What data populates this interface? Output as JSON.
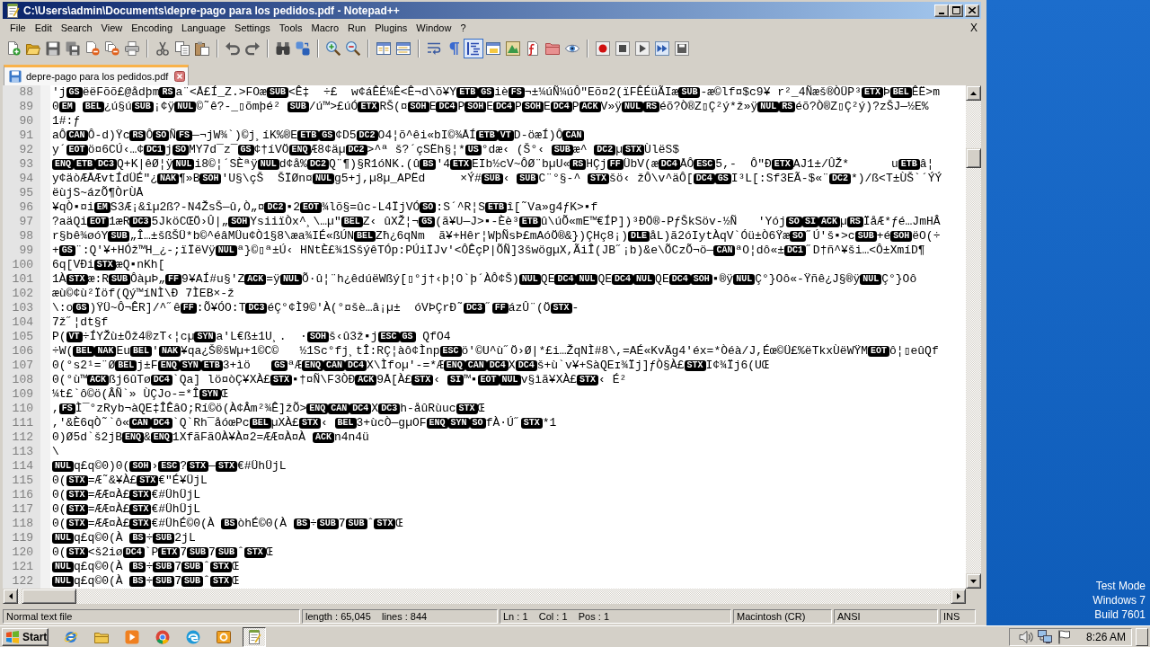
{
  "window": {
    "title": "C:\\Users\\admin\\Documents\\depre-pago para los pedidos.pdf - Notepad++"
  },
  "menu": {
    "items": [
      "File",
      "Edit",
      "Search",
      "View",
      "Encoding",
      "Language",
      "Settings",
      "Tools",
      "Macro",
      "Run",
      "Plugins",
      "Window",
      "?"
    ],
    "close_document": "X"
  },
  "toolbar": {
    "buttons": [
      {
        "pressed": false
      },
      {
        "pressed": false
      },
      {
        "pressed": false
      },
      {
        "pressed": false
      },
      {
        "pressed": false
      },
      {
        "pressed": false
      },
      {
        "pressed": false
      },
      {
        "pressed": false
      },
      {
        "pressed": false
      },
      {
        "pressed": false
      },
      {
        "pressed": false
      },
      {
        "pressed": false
      },
      {
        "pressed": false
      },
      {
        "pressed": false
      },
      {
        "pressed": false
      },
      {
        "pressed": false
      },
      {
        "pressed": false
      },
      {
        "pressed": false
      },
      {
        "pressed": false
      },
      {
        "pressed": false
      },
      {
        "pressed": true
      },
      {
        "pressed": false
      },
      {
        "pressed": false
      },
      {
        "pressed": false
      },
      {
        "pressed": false
      },
      {
        "pressed": false
      },
      {
        "pressed": false
      },
      {
        "pressed": false
      },
      {
        "pressed": false
      },
      {
        "pressed": false
      },
      {
        "pressed": false
      }
    ]
  },
  "tabs": [
    {
      "label": "depre-pago para los pedidos.pdf",
      "selected": true
    }
  ],
  "editor": {
    "lines": [
      {
        "number": "88",
        "segments": [
          {
            "kind": "text",
            "text": "'j"
          },
          {
            "kind": "control",
            "text": "GS"
          },
          {
            "kind": "text",
            "text": "ëëFõõ£@ådþm"
          },
          {
            "kind": "control",
            "text": "RS"
          },
          {
            "kind": "text",
            "text": "a¨<Å£Í_Z.>FOæ"
          },
          {
            "kind": "control",
            "text": "SUB"
          },
          {
            "kind": "text",
            "text": "<Ê‡  ÷£  w¢áÊÉ¼Ê<Ê¬d\\õ¥Y"
          },
          {
            "kind": "control",
            "text": "ETB"
          },
          {
            "kind": "control",
            "text": "GS"
          },
          {
            "kind": "text",
            "text": "iè"
          },
          {
            "kind": "control",
            "text": "FS"
          },
          {
            "kind": "text",
            "text": "¬±¼úÑ¼úÔ\"Eõ¤2(ïFÊÉüÃIæ"
          },
          {
            "kind": "control",
            "text": "SUB"
          },
          {
            "kind": "text",
            "text": "-æ©lf¤$c9¥ r²_4Ñæš®ÒÜP³"
          },
          {
            "kind": "control",
            "text": "ETX"
          },
          {
            "kind": "text",
            "text": "Þ"
          },
          {
            "kind": "control",
            "text": "BEL"
          },
          {
            "kind": "text",
            "text": "ÊË>m"
          }
        ]
      },
      {
        "number": "89",
        "segments": [
          {
            "kind": "text",
            "text": "0"
          },
          {
            "kind": "control",
            "text": "EM"
          },
          {
            "kind": "space"
          },
          {
            "kind": "control",
            "text": "BEL"
          },
          {
            "kind": "text",
            "text": "¿ú§ú"
          },
          {
            "kind": "control",
            "text": "SUB"
          },
          {
            "kind": "text",
            "text": "¡¢ÿ"
          },
          {
            "kind": "control",
            "text": "NUL"
          },
          {
            "kind": "text",
            "text": "©˜ê?-_▯õmþé² "
          },
          {
            "kind": "control",
            "text": "SUB"
          },
          {
            "kind": "text",
            "text": "/ú™>£úÓ"
          },
          {
            "kind": "control",
            "text": "ETX"
          },
          {
            "kind": "text",
            "text": "RŠ(¤"
          },
          {
            "kind": "control",
            "text": "SOH"
          },
          {
            "kind": "text",
            "text": "E"
          },
          {
            "kind": "control",
            "text": "DC4"
          },
          {
            "kind": "text",
            "text": "P"
          },
          {
            "kind": "control",
            "text": "SOH"
          },
          {
            "kind": "text",
            "text": "E"
          },
          {
            "kind": "control",
            "text": "DC4"
          },
          {
            "kind": "text",
            "text": "P"
          },
          {
            "kind": "control",
            "text": "SOH"
          },
          {
            "kind": "text",
            "text": "E"
          },
          {
            "kind": "control",
            "text": "DC4"
          },
          {
            "kind": "text",
            "text": "P"
          },
          {
            "kind": "control",
            "text": "ACK"
          },
          {
            "kind": "text",
            "text": "V»ÿ"
          },
          {
            "kind": "control",
            "text": "NUL"
          },
          {
            "kind": "control",
            "text": "RS"
          },
          {
            "kind": "text",
            "text": "éõ?Ò®Z▯Ç²ý*ž»ÿ"
          },
          {
            "kind": "control",
            "text": "NUL"
          },
          {
            "kind": "control",
            "text": "RS"
          },
          {
            "kind": "text",
            "text": "éõ?Ò®Z▯Ç²ý)?zŠJ—½E%"
          }
        ]
      },
      {
        "number": "90",
        "segments": [
          {
            "kind": "text",
            "text": "1#:ƒ"
          }
        ]
      },
      {
        "number": "91",
        "segments": [
          {
            "kind": "text",
            "text": "aÔ"
          },
          {
            "kind": "control",
            "text": "CAN"
          },
          {
            "kind": "text",
            "text": "Ô-d)Ÿc"
          },
          {
            "kind": "control",
            "text": "RS"
          },
          {
            "kind": "text",
            "text": "Ô"
          },
          {
            "kind": "control",
            "text": "SO"
          },
          {
            "kind": "text",
            "text": "Ñ"
          },
          {
            "kind": "control",
            "text": "FS"
          },
          {
            "kind": "text",
            "text": "—¬jW¾`)©j¸íK%®E"
          },
          {
            "kind": "control",
            "text": "ETB"
          },
          {
            "kind": "control",
            "text": "GS"
          },
          {
            "kind": "text",
            "text": "¢D5"
          },
          {
            "kind": "control",
            "text": "DC2"
          },
          {
            "kind": "text",
            "text": "O4¦õ^êi«bI©¾ÅÍ"
          },
          {
            "kind": "control",
            "text": "ETB"
          },
          {
            "kind": "control",
            "text": "VT"
          },
          {
            "kind": "text",
            "text": "D-öæÍ)Ô"
          },
          {
            "kind": "control",
            "text": "CAN"
          }
        ]
      },
      {
        "number": "92",
        "segments": [
          {
            "kind": "text",
            "text": "y´"
          },
          {
            "kind": "control",
            "text": "EOT"
          },
          {
            "kind": "text",
            "text": "ö¤6CÚ‹…¢"
          },
          {
            "kind": "control",
            "text": "DC1"
          },
          {
            "kind": "text",
            "text": "j"
          },
          {
            "kind": "control",
            "text": "SO"
          },
          {
            "kind": "text",
            "text": "MY7d¯z¯"
          },
          {
            "kind": "control",
            "text": "GS"
          },
          {
            "kind": "text",
            "text": "¢†íVÖ"
          },
          {
            "kind": "control",
            "text": "ENQ"
          },
          {
            "kind": "text",
            "text": "Æ8¢äµ"
          },
          {
            "kind": "control",
            "text": "DC2"
          },
          {
            "kind": "text",
            "text": ">^ª š?´çSËh§¦*"
          },
          {
            "kind": "control",
            "text": "US"
          },
          {
            "kind": "text",
            "text": "°dæ‹ (Š°‹ "
          },
          {
            "kind": "control",
            "text": "SUB"
          },
          {
            "kind": "text",
            "text": "æ^ "
          },
          {
            "kind": "control",
            "text": "DC2"
          },
          {
            "kind": "text",
            "text": "µ"
          },
          {
            "kind": "control",
            "text": "STX"
          },
          {
            "kind": "text",
            "text": "ÙlëS$"
          }
        ]
      },
      {
        "number": "93",
        "segments": [
          {
            "kind": "control",
            "text": "ENQ"
          },
          {
            "kind": "control",
            "text": "ETB"
          },
          {
            "kind": "control",
            "text": "DC3"
          },
          {
            "kind": "text",
            "text": "Q+K|êØ¦ÿ"
          },
          {
            "kind": "control",
            "text": "NUL"
          },
          {
            "kind": "text",
            "text": "i8©¦´SÈªÿ"
          },
          {
            "kind": "control",
            "text": "NUL"
          },
          {
            "kind": "text",
            "text": "d¢å%"
          },
          {
            "kind": "control",
            "text": "DC2"
          },
          {
            "kind": "text",
            "text": "Q¨¶)§R1óNK.(û"
          },
          {
            "kind": "control",
            "text": "BS"
          },
          {
            "kind": "text",
            "text": "'4"
          },
          {
            "kind": "control",
            "text": "ETX"
          },
          {
            "kind": "text",
            "text": "EIb½cV~ÔØ¨bµU«"
          },
          {
            "kind": "control",
            "text": "RS"
          },
          {
            "kind": "text",
            "text": "HÇj"
          },
          {
            "kind": "control",
            "text": "FF"
          },
          {
            "kind": "text",
            "text": "ÜbV(æ"
          },
          {
            "kind": "control",
            "text": "DC4"
          },
          {
            "kind": "text",
            "text": "ÅÔ"
          },
          {
            "kind": "control",
            "text": "ESC"
          },
          {
            "kind": "text",
            "text": "5,-  Ô\"Ð"
          },
          {
            "kind": "control",
            "text": "ETX"
          },
          {
            "kind": "text",
            "text": "AJ1±/ÛŽ*      u"
          },
          {
            "kind": "control",
            "text": "ETB"
          },
          {
            "kind": "text",
            "text": "â¦"
          }
        ]
      },
      {
        "number": "94",
        "segments": [
          {
            "kind": "text",
            "text": "y¢äòÆÅÆvtÍdÜÉ\"¿"
          },
          {
            "kind": "control",
            "text": "NAK"
          },
          {
            "kind": "text",
            "text": "¶»B"
          },
          {
            "kind": "control",
            "text": "SOH"
          },
          {
            "kind": "text",
            "text": "'U§\\çŠ  ŠÏØn¤"
          },
          {
            "kind": "control",
            "text": "NUL"
          },
          {
            "kind": "text",
            "text": "g5+j,µ8µ_APËd     ×Ý#"
          },
          {
            "kind": "control",
            "text": "SUB"
          },
          {
            "kind": "text",
            "text": "‹ "
          },
          {
            "kind": "control",
            "text": "SUB"
          },
          {
            "kind": "text",
            "text": "C¨°§-^ "
          },
          {
            "kind": "control",
            "text": "STX"
          },
          {
            "kind": "text",
            "text": "šö‹ žÔ\\v^äÔ["
          },
          {
            "kind": "control",
            "text": "DC4"
          },
          {
            "kind": "control",
            "text": "GS"
          },
          {
            "kind": "text",
            "text": "I³L[:Sf3EÃ-$«¨"
          },
          {
            "kind": "control",
            "text": "DC2"
          },
          {
            "kind": "text",
            "text": "*)/ß<T±ÙŠ`´ÝÝ"
          }
        ]
      },
      {
        "number": "95",
        "segments": [
          {
            "kind": "text",
            "text": "ëùjS~ázÕ¶ÒrÙÅ"
          }
        ]
      },
      {
        "number": "96",
        "segments": [
          {
            "kind": "text",
            "text": "¥qÒ▪¤i"
          },
          {
            "kind": "control",
            "text": "EM"
          },
          {
            "kind": "text",
            "text": "S3Æ¡&îµ2ß?-N4ŽsŠ—û,Ò„¤"
          },
          {
            "kind": "control",
            "text": "DC2"
          },
          {
            "kind": "text",
            "text": "▪2"
          },
          {
            "kind": "control",
            "text": "EOT"
          },
          {
            "kind": "text",
            "text": "¾lõ§=ûc-L4ÏjVÓ"
          },
          {
            "kind": "control",
            "text": "SO"
          },
          {
            "kind": "text",
            "text": ":S´^R¦S"
          },
          {
            "kind": "control",
            "text": "ETB"
          },
          {
            "kind": "text",
            "text": "î[˜Va»g4ƒK>▪f"
          }
        ]
      },
      {
        "number": "97",
        "segments": [
          {
            "kind": "text",
            "text": "?aäQi"
          },
          {
            "kind": "control",
            "text": "EOT"
          },
          {
            "kind": "text",
            "text": "1æR"
          },
          {
            "kind": "control",
            "text": "DC3"
          },
          {
            "kind": "text",
            "text": "5JköCŒÖ›Û|„"
          },
          {
            "kind": "control",
            "text": "SOH"
          },
          {
            "kind": "text",
            "text": "YsiiïÒx^¸\\…µ\""
          },
          {
            "kind": "control",
            "text": "BEL"
          },
          {
            "kind": "text",
            "text": "Z‹ ûXŽ¦¬"
          },
          {
            "kind": "control",
            "text": "GS"
          },
          {
            "kind": "text",
            "text": "(ã¥U—J>▪-Èè³"
          },
          {
            "kind": "control",
            "text": "ETB"
          },
          {
            "kind": "text",
            "text": "û\\úÕ«mE™€ÍP])³ÐÖ®-PƒŠkSöv-½Ñ   'Yój"
          },
          {
            "kind": "control",
            "text": "SO"
          },
          {
            "kind": "control",
            "text": "SI"
          },
          {
            "kind": "control",
            "text": "ACK"
          },
          {
            "kind": "text",
            "text": "µ"
          },
          {
            "kind": "control",
            "text": "RS"
          },
          {
            "kind": "text",
            "text": "ÏåÆ*ƒé…JmHÂ"
          }
        ]
      },
      {
        "number": "98",
        "segments": [
          {
            "kind": "text",
            "text": "r§bê¾øóY"
          },
          {
            "kind": "control",
            "text": "SUB"
          },
          {
            "kind": "text",
            "text": "„Î…±šßŠÜ*b©^éâMÜu¢Ò1§8\\æa¾IÉ«ßÚN"
          },
          {
            "kind": "control",
            "text": "BEL"
          },
          {
            "kind": "text",
            "text": "Zħ¿6qNm  ã¥+Hêr¦WþÑsÞ£mAóÖ®&})ÇHç8¡)"
          },
          {
            "kind": "control",
            "text": "DLE"
          },
          {
            "kind": "text",
            "text": "åL)ã2óIytÀqV`Óü±Ò6Ÿæ"
          },
          {
            "kind": "control",
            "text": "SO"
          },
          {
            "kind": "text",
            "text": "˝Ú'š▪>c"
          },
          {
            "kind": "control",
            "text": "SUB"
          },
          {
            "kind": "text",
            "text": "+é"
          },
          {
            "kind": "control",
            "text": "SOH"
          },
          {
            "kind": "text",
            "text": "ëO(÷"
          }
        ]
      },
      {
        "number": "99",
        "segments": [
          {
            "kind": "text",
            "text": "+"
          },
          {
            "kind": "control",
            "text": "GS"
          },
          {
            "kind": "text",
            "text": "¨:Q'¥+HÓž™H_¿-;ïÏëVÿ"
          },
          {
            "kind": "control",
            "text": "NUL"
          },
          {
            "kind": "text",
            "text": "ª}©▯ª±Ú‹ HNtÈ£¾1SšýêTÓp:PÚiÏJv'<ÔÊçP|ÕÑ]3šwögµX,ÃiÎ(JB˝¡b)&e\\ÕCzÕ¬ö—"
          },
          {
            "kind": "control",
            "text": "CAN"
          },
          {
            "kind": "text",
            "text": "ªO¦dô«±"
          },
          {
            "kind": "control",
            "text": "DC1"
          },
          {
            "kind": "text",
            "text": "˝D†ñ^¥ši…<Ô±XmíD¶"
          }
        ]
      },
      {
        "number": "100",
        "segments": [
          {
            "kind": "text",
            "text": "6q[VÐi"
          },
          {
            "kind": "control",
            "text": "STX"
          },
          {
            "kind": "text",
            "text": "æQ▪nKh["
          }
        ]
      },
      {
        "number": "101",
        "segments": [
          {
            "kind": "text",
            "text": "1À"
          },
          {
            "kind": "control",
            "text": "STX"
          },
          {
            "kind": "text",
            "text": "æ:R"
          },
          {
            "kind": "control",
            "text": "SUB"
          },
          {
            "kind": "text",
            "text": "ÔàµÞ„"
          },
          {
            "kind": "control",
            "text": "FF"
          },
          {
            "kind": "text",
            "text": "9¥AÍ#u§'Z"
          },
          {
            "kind": "control",
            "text": "ACK"
          },
          {
            "kind": "text",
            "text": "=ÿ"
          },
          {
            "kind": "control",
            "text": "NUL"
          },
          {
            "kind": "text",
            "text": "Õ·û¦¨h¿êdúëWßý[▯°j†‹þ¦O`þ´ÀÔ¢Š)"
          },
          {
            "kind": "control",
            "text": "NUL"
          },
          {
            "kind": "text",
            "text": "QE"
          },
          {
            "kind": "control",
            "text": "DC4"
          },
          {
            "kind": "control",
            "text": "NUL"
          },
          {
            "kind": "text",
            "text": "QE"
          },
          {
            "kind": "control",
            "text": "DC4"
          },
          {
            "kind": "control",
            "text": "NUL"
          },
          {
            "kind": "text",
            "text": "QE"
          },
          {
            "kind": "control",
            "text": "DC4"
          },
          {
            "kind": "control",
            "text": "SOH"
          },
          {
            "kind": "text",
            "text": "▪®ÿ"
          },
          {
            "kind": "control",
            "text": "NUL"
          },
          {
            "kind": "text",
            "text": "Ç°}Oô«-Ÿñê¿J§®ÿ"
          },
          {
            "kind": "control",
            "text": "NUL"
          },
          {
            "kind": "text",
            "text": "Ç°}Oô"
          }
        ]
      },
      {
        "number": "102",
        "segments": [
          {
            "kind": "text",
            "text": "æù©¢ù²Ïöf(Qý™íNÌ\\Ð 7ÌEB×-ž"
          }
        ]
      },
      {
        "number": "103",
        "segments": [
          {
            "kind": "text",
            "text": "\\:o"
          },
          {
            "kind": "control",
            "text": "GS"
          },
          {
            "kind": "text",
            "text": ")ŸÜ~Ô¬ÊR]/^˝ê"
          },
          {
            "kind": "control",
            "text": "FF"
          },
          {
            "kind": "text",
            "text": ":Õ¥ÓO:T"
          },
          {
            "kind": "control",
            "text": "DC3"
          },
          {
            "kind": "text",
            "text": "éÇ°¢Ì9©'À(°¤šè…â¡µ±  óVÞÇrÐ˜"
          },
          {
            "kind": "control",
            "text": "DC3"
          },
          {
            "kind": "text",
            "text": "˝"
          },
          {
            "kind": "control",
            "text": "FF"
          },
          {
            "kind": "text",
            "text": "ázÛ¨(Ö"
          },
          {
            "kind": "control",
            "text": "STX"
          },
          {
            "kind": "text",
            "text": "-"
          }
        ]
      },
      {
        "number": "104",
        "segments": [
          {
            "kind": "text",
            "text": "7ž˝¦dt§f"
          }
        ]
      },
      {
        "number": "105",
        "segments": [
          {
            "kind": "text",
            "text": "P("
          },
          {
            "kind": "control",
            "text": "VT"
          },
          {
            "kind": "text",
            "text": "÷ÍYŽù±Öž4®zT‹¦cµ"
          },
          {
            "kind": "control",
            "text": "SYN"
          },
          {
            "kind": "text",
            "text": "a'L€ß±1U¸.  ·"
          },
          {
            "kind": "control",
            "text": "SOH"
          },
          {
            "kind": "text",
            "text": "š‹û3ž▪j"
          },
          {
            "kind": "control",
            "text": "ESC"
          },
          {
            "kind": "control",
            "text": "GS"
          },
          {
            "kind": "text",
            "text": " QfO4"
          }
        ]
      },
      {
        "number": "106",
        "segments": [
          {
            "kind": "text",
            "text": "÷W("
          },
          {
            "kind": "control",
            "text": "BEL"
          },
          {
            "kind": "control",
            "text": "NAK"
          },
          {
            "kind": "text",
            "text": "Eu"
          },
          {
            "kind": "control",
            "text": "BEL"
          },
          {
            "kind": "text",
            "text": "'"
          },
          {
            "kind": "control",
            "text": "NAK"
          },
          {
            "kind": "text",
            "text": "¥qa¿Š®šWµ+1©C©   ½1Sc°fj¸tÎ:RÇ¦àô¢Ìnp"
          },
          {
            "kind": "control",
            "text": "ESC"
          },
          {
            "kind": "text",
            "text": "ö'©U^ù˝Ö›Ø|*£i…ŽqNÌ#8\\,=AÉ«KvÄg4'éx=*Òéà/J,Éœ©Ü£%ëTkxÙëWŸM"
          },
          {
            "kind": "control",
            "text": "EOT"
          },
          {
            "kind": "text",
            "text": "ô¦▯eûQf"
          }
        ]
      },
      {
        "number": "107",
        "segments": [
          {
            "kind": "text",
            "text": "0(°s2¹=¨Ø"
          },
          {
            "kind": "control",
            "text": "BEL"
          },
          {
            "kind": "text",
            "text": "j±F"
          },
          {
            "kind": "control",
            "text": "ENQ"
          },
          {
            "kind": "control",
            "text": "SYN"
          },
          {
            "kind": "control",
            "text": "ETB"
          },
          {
            "kind": "text",
            "text": "3+ìö   "
          },
          {
            "kind": "control",
            "text": "GS"
          },
          {
            "kind": "text",
            "text": "ªÆ"
          },
          {
            "kind": "control",
            "text": "ENQ"
          },
          {
            "kind": "control",
            "text": "CAN"
          },
          {
            "kind": "control",
            "text": "DC4"
          },
          {
            "kind": "text",
            "text": "X\\Ìfoµ'-=*Æ"
          },
          {
            "kind": "control",
            "text": "ENQ"
          },
          {
            "kind": "control",
            "text": "CAN"
          },
          {
            "kind": "control",
            "text": "DC4"
          },
          {
            "kind": "text",
            "text": "X"
          },
          {
            "kind": "control",
            "text": "DC4"
          },
          {
            "kind": "text",
            "text": "š+ù`v¥+SàQEɪ¾Ïj]ƒÒ§À£"
          },
          {
            "kind": "control",
            "text": "STX"
          },
          {
            "kind": "text",
            "text": "I¢¾Ïj6(UŒ"
          }
        ]
      },
      {
        "number": "108",
        "segments": [
          {
            "kind": "text",
            "text": "0(°ù™"
          },
          {
            "kind": "control",
            "text": "ACK"
          },
          {
            "kind": "text",
            "text": "ßj6ûTø"
          },
          {
            "kind": "control",
            "text": "DC4"
          },
          {
            "kind": "text",
            "text": "`Qa] lö¤òÇ¥XÀ£"
          },
          {
            "kind": "control",
            "text": "STX"
          },
          {
            "kind": "text",
            "text": "▪†¤Ñ\\F3ÒÐ"
          },
          {
            "kind": "control",
            "text": "ACK"
          },
          {
            "kind": "text",
            "text": "9Å[À£"
          },
          {
            "kind": "control",
            "text": "STX"
          },
          {
            "kind": "text",
            "text": "‹ "
          },
          {
            "kind": "control",
            "text": "SI"
          },
          {
            "kind": "text",
            "text": "™▪"
          },
          {
            "kind": "control",
            "text": "EOT"
          },
          {
            "kind": "control",
            "text": "NUL"
          },
          {
            "kind": "text",
            "text": "v§ìã¥XÀ£"
          },
          {
            "kind": "control",
            "text": "STX"
          },
          {
            "kind": "text",
            "text": "‹ É²"
          }
        ]
      },
      {
        "number": "109",
        "segments": [
          {
            "kind": "text",
            "text": "¼t£`ô©ö(ÂÑ`» ÙÇJo-=*Î"
          },
          {
            "kind": "control",
            "text": "SYN"
          },
          {
            "kind": "text",
            "text": "Œ"
          }
        ]
      },
      {
        "number": "110",
        "segments": [
          {
            "kind": "text",
            "text": ","
          },
          {
            "kind": "control",
            "text": "FS"
          },
          {
            "kind": "text",
            "text": "Ì¯°zRyb¬àQE‡ÎÊâO;Rí©ö(À¢Âm²¾Ê]žÕ>"
          },
          {
            "kind": "control",
            "text": "ENQ"
          },
          {
            "kind": "control",
            "text": "CAN"
          },
          {
            "kind": "control",
            "text": "DC4"
          },
          {
            "kind": "text",
            "text": "X"
          },
          {
            "kind": "control",
            "text": "DC3"
          },
          {
            "kind": "text",
            "text": "h-åûRùuc"
          },
          {
            "kind": "control",
            "text": "STX"
          },
          {
            "kind": "text",
            "text": "Œ"
          }
        ]
      },
      {
        "number": "111",
        "segments": [
          {
            "kind": "text",
            "text": ",'&È6qÒ˜`ô«"
          },
          {
            "kind": "control",
            "text": "CAN"
          },
          {
            "kind": "control",
            "text": "DC4"
          },
          {
            "kind": "text",
            "text": "`Q`Rh¯åóœPc"
          },
          {
            "kind": "control",
            "text": "BEL"
          },
          {
            "kind": "text",
            "text": "µXÀ£"
          },
          {
            "kind": "control",
            "text": "STX"
          },
          {
            "kind": "text",
            "text": "‹ "
          },
          {
            "kind": "control",
            "text": "BEL"
          },
          {
            "kind": "text",
            "text": "3+ùcÒ—gµOF"
          },
          {
            "kind": "control",
            "text": "ENQ"
          },
          {
            "kind": "control",
            "text": "SYN"
          },
          {
            "kind": "control",
            "text": "SO"
          },
          {
            "kind": "text",
            "text": "fÀ·Ú˝"
          },
          {
            "kind": "control",
            "text": "STX"
          },
          {
            "kind": "text",
            "text": "*1"
          }
        ]
      },
      {
        "number": "112",
        "segments": [
          {
            "kind": "text",
            "text": "0)Ø5d`š2jB"
          },
          {
            "kind": "control",
            "text": "ENQ"
          },
          {
            "kind": "text",
            "text": "&"
          },
          {
            "kind": "control",
            "text": "ENQ"
          },
          {
            "kind": "text",
            "text": "1XfãFãOÀ¥À¤2=ÆÆ¤À¤À "
          },
          {
            "kind": "control",
            "text": "ACK"
          },
          {
            "kind": "text",
            "text": "n4n4ü"
          }
        ]
      },
      {
        "number": "113",
        "segments": [
          {
            "kind": "text",
            "text": "\\"
          }
        ]
      },
      {
        "number": "114",
        "segments": [
          {
            "kind": "control",
            "text": "NUL"
          },
          {
            "kind": "text",
            "text": "q£q©0)0("
          },
          {
            "kind": "control",
            "text": "SOH"
          },
          {
            "kind": "text",
            "text": "›"
          },
          {
            "kind": "control",
            "text": "ESC"
          },
          {
            "kind": "text",
            "text": "?"
          },
          {
            "kind": "control",
            "text": "STX"
          },
          {
            "kind": "text",
            "text": "—"
          },
          {
            "kind": "control",
            "text": "STX"
          },
          {
            "kind": "text",
            "text": "€#ÜhÜjL"
          }
        ]
      },
      {
        "number": "115",
        "segments": [
          {
            "kind": "text",
            "text": "0("
          },
          {
            "kind": "control",
            "text": "STX"
          },
          {
            "kind": "text",
            "text": "=Æ˜&¥À£"
          },
          {
            "kind": "control",
            "text": "STX"
          },
          {
            "kind": "text",
            "text": "€\"É¥ÜjL"
          }
        ]
      },
      {
        "number": "116",
        "segments": [
          {
            "kind": "text",
            "text": "0("
          },
          {
            "kind": "control",
            "text": "STX"
          },
          {
            "kind": "text",
            "text": "=ÆÆ¤À£"
          },
          {
            "kind": "control",
            "text": "STX"
          },
          {
            "kind": "text",
            "text": "€#ÜhÜjL"
          }
        ]
      },
      {
        "number": "117",
        "segments": [
          {
            "kind": "text",
            "text": "0("
          },
          {
            "kind": "control",
            "text": "STX"
          },
          {
            "kind": "text",
            "text": "=ÆÆ¤À£"
          },
          {
            "kind": "control",
            "text": "STX"
          },
          {
            "kind": "text",
            "text": "€#ÜhÜjL"
          }
        ]
      },
      {
        "number": "118",
        "segments": [
          {
            "kind": "text",
            "text": "0("
          },
          {
            "kind": "control",
            "text": "STX"
          },
          {
            "kind": "text",
            "text": "=ÆÆ¤À£"
          },
          {
            "kind": "control",
            "text": "STX"
          },
          {
            "kind": "text",
            "text": "€#ÜhÉ©0(À "
          },
          {
            "kind": "control",
            "text": "BS"
          },
          {
            "kind": "text",
            "text": "òhÉ©0(À "
          },
          {
            "kind": "control",
            "text": "BS"
          },
          {
            "kind": "text",
            "text": "÷"
          },
          {
            "kind": "control",
            "text": "SUB"
          },
          {
            "kind": "text",
            "text": "7"
          },
          {
            "kind": "control",
            "text": "SUB"
          },
          {
            "kind": "text",
            "text": "ˆ"
          },
          {
            "kind": "control",
            "text": "STX"
          },
          {
            "kind": "text",
            "text": "Œ"
          }
        ]
      },
      {
        "number": "119",
        "segments": [
          {
            "kind": "control",
            "text": "NUL"
          },
          {
            "kind": "text",
            "text": "q£q©0(À "
          },
          {
            "kind": "control",
            "text": "BS"
          },
          {
            "kind": "text",
            "text": "÷"
          },
          {
            "kind": "control",
            "text": "SUB"
          },
          {
            "kind": "text",
            "text": "2jL"
          }
        ]
      },
      {
        "number": "120",
        "segments": [
          {
            "kind": "text",
            "text": "0("
          },
          {
            "kind": "control",
            "text": "STX"
          },
          {
            "kind": "text",
            "text": "<š2iø"
          },
          {
            "kind": "control",
            "text": "DC4"
          },
          {
            "kind": "text",
            "text": "`P"
          },
          {
            "kind": "control",
            "text": "ETX"
          },
          {
            "kind": "text",
            "text": "7"
          },
          {
            "kind": "control",
            "text": "SUB"
          },
          {
            "kind": "text",
            "text": "7"
          },
          {
            "kind": "control",
            "text": "SUB"
          },
          {
            "kind": "text",
            "text": "ˆ"
          },
          {
            "kind": "control",
            "text": "STX"
          },
          {
            "kind": "text",
            "text": "Œ"
          }
        ]
      },
      {
        "number": "121",
        "segments": [
          {
            "kind": "control",
            "text": "NUL"
          },
          {
            "kind": "text",
            "text": "q£q©0(À "
          },
          {
            "kind": "control",
            "text": "BS"
          },
          {
            "kind": "text",
            "text": "÷"
          },
          {
            "kind": "control",
            "text": "SUB"
          },
          {
            "kind": "text",
            "text": "7"
          },
          {
            "kind": "control",
            "text": "SUB"
          },
          {
            "kind": "text",
            "text": "ˆ"
          },
          {
            "kind": "control",
            "text": "STX"
          },
          {
            "kind": "text",
            "text": "Œ"
          }
        ]
      },
      {
        "number": "122",
        "segments": [
          {
            "kind": "control",
            "text": "NUL"
          },
          {
            "kind": "text",
            "text": "q£q©0(À "
          },
          {
            "kind": "control",
            "text": "BS"
          },
          {
            "kind": "text",
            "text": "÷"
          },
          {
            "kind": "control",
            "text": "SUB"
          },
          {
            "kind": "text",
            "text": "7"
          },
          {
            "kind": "control",
            "text": "SUB"
          },
          {
            "kind": "text",
            "text": "ˆ"
          },
          {
            "kind": "control",
            "text": "STX"
          },
          {
            "kind": "text",
            "text": "Œ"
          }
        ]
      }
    ]
  },
  "status_bar": {
    "file_type": "Normal text file",
    "length_lines": "length : 65,045    lines : 844",
    "position": "Ln : 1    Col : 1    Pos : 1",
    "eol": "Macintosh (CR)",
    "encoding": "ANSI",
    "mode": "INS"
  },
  "desktop": {
    "notice": [
      "Test Mode",
      "Windows 7",
      "Build 7601"
    ]
  },
  "taskbar": {
    "start": "Start",
    "apps": [
      {
        "selected": false
      },
      {
        "selected": false
      },
      {
        "selected": false
      },
      {
        "selected": false
      },
      {
        "selected": false
      },
      {
        "selected": false
      },
      {
        "selected": true
      }
    ],
    "clock": "8:26 AM"
  }
}
